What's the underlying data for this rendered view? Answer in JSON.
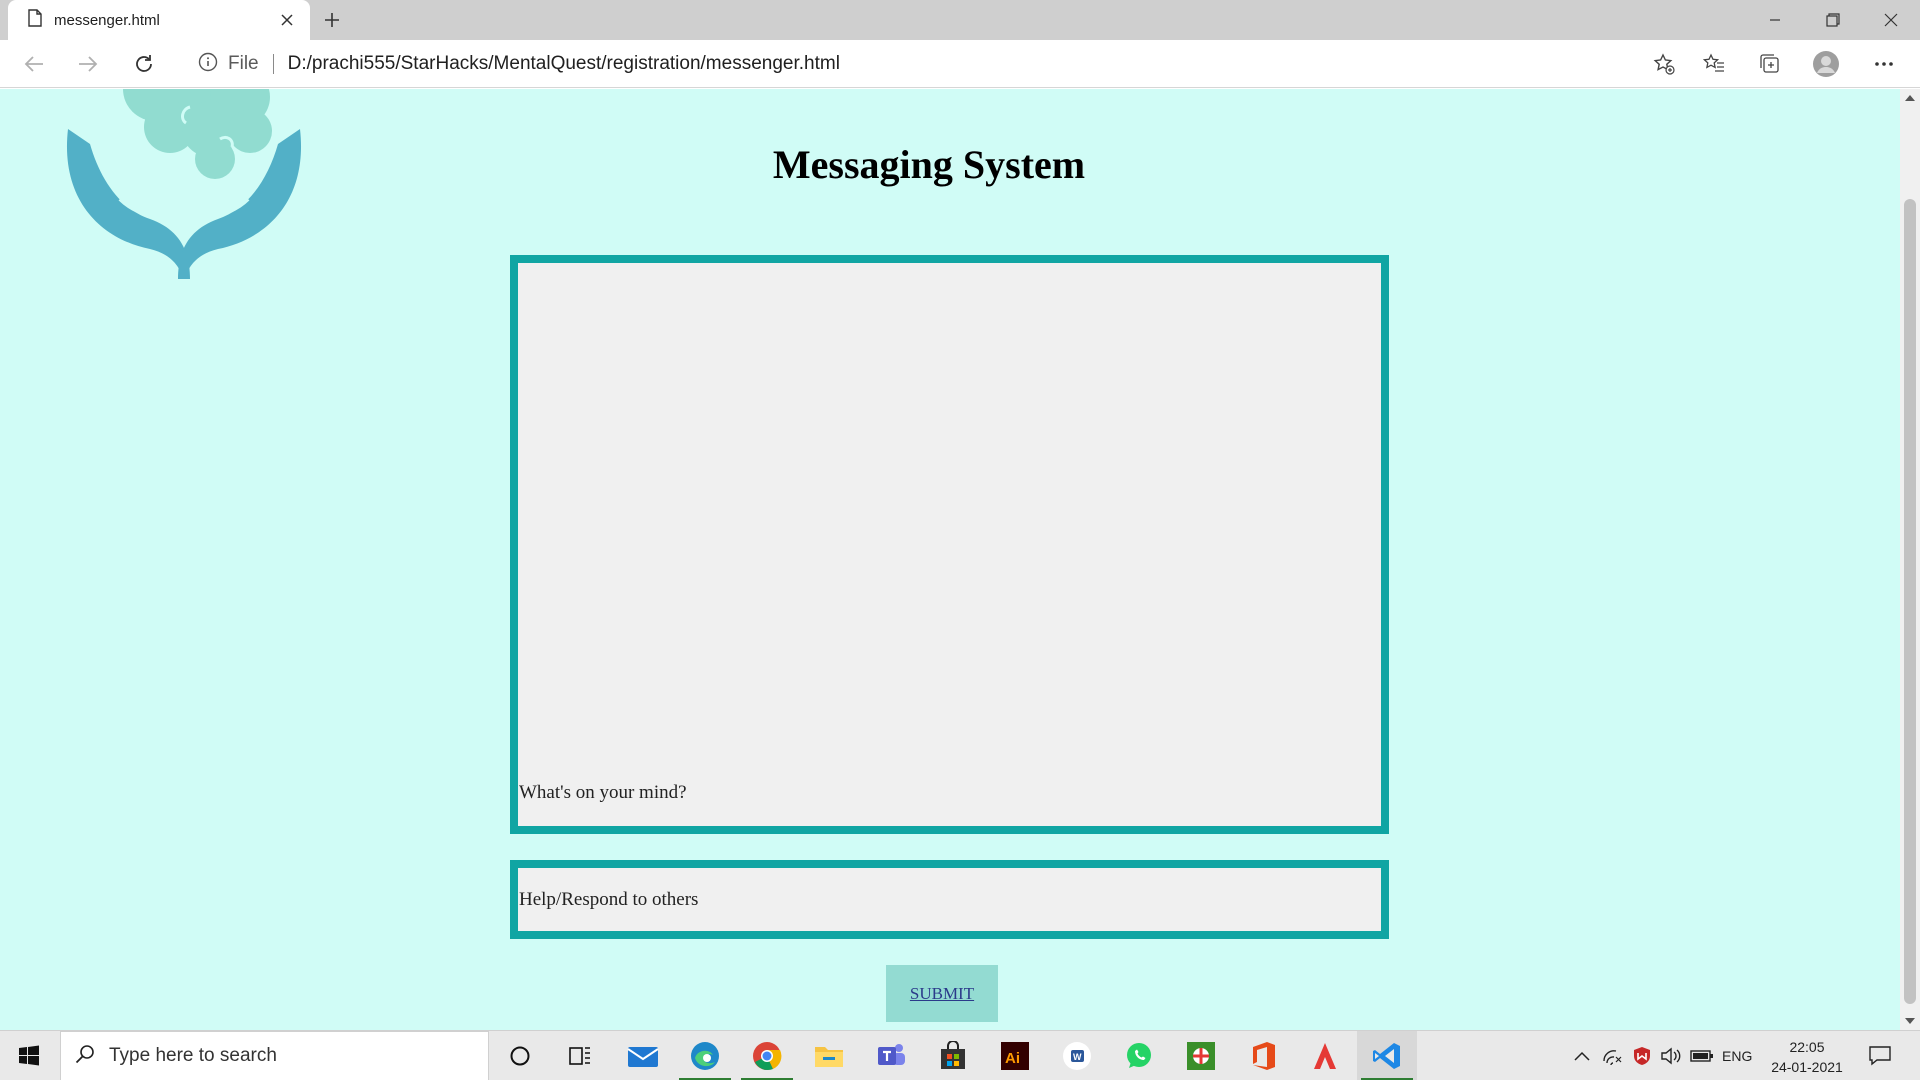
{
  "browser": {
    "tab_title": "messenger.html",
    "file_label": "File",
    "url": "D:/prachi555/StarHacks/MentalQuest/registration/messenger.html"
  },
  "page": {
    "title": "Messaging System",
    "message_placeholder": "What's on your mind?",
    "help_placeholder": "Help/Respond to others",
    "submit_label": "SUBMIT",
    "background_color": "#d0fcf6",
    "box_border_color": "#10a5a3",
    "button_color": "#93dbd2"
  },
  "taskbar": {
    "search_placeholder": "Type here to search",
    "apps": [
      "cortana-icon",
      "task-view-icon",
      "mail-icon",
      "edge-icon",
      "chrome-icon",
      "file-explorer-icon",
      "teams-icon",
      "store-icon",
      "illustrator-icon",
      "word-icon",
      "whatsapp-icon",
      "app-icon",
      "office-icon",
      "acrobat-icon",
      "vscode-icon"
    ],
    "lang": "ENG",
    "time": "22:05",
    "date": "24-01-2021"
  }
}
